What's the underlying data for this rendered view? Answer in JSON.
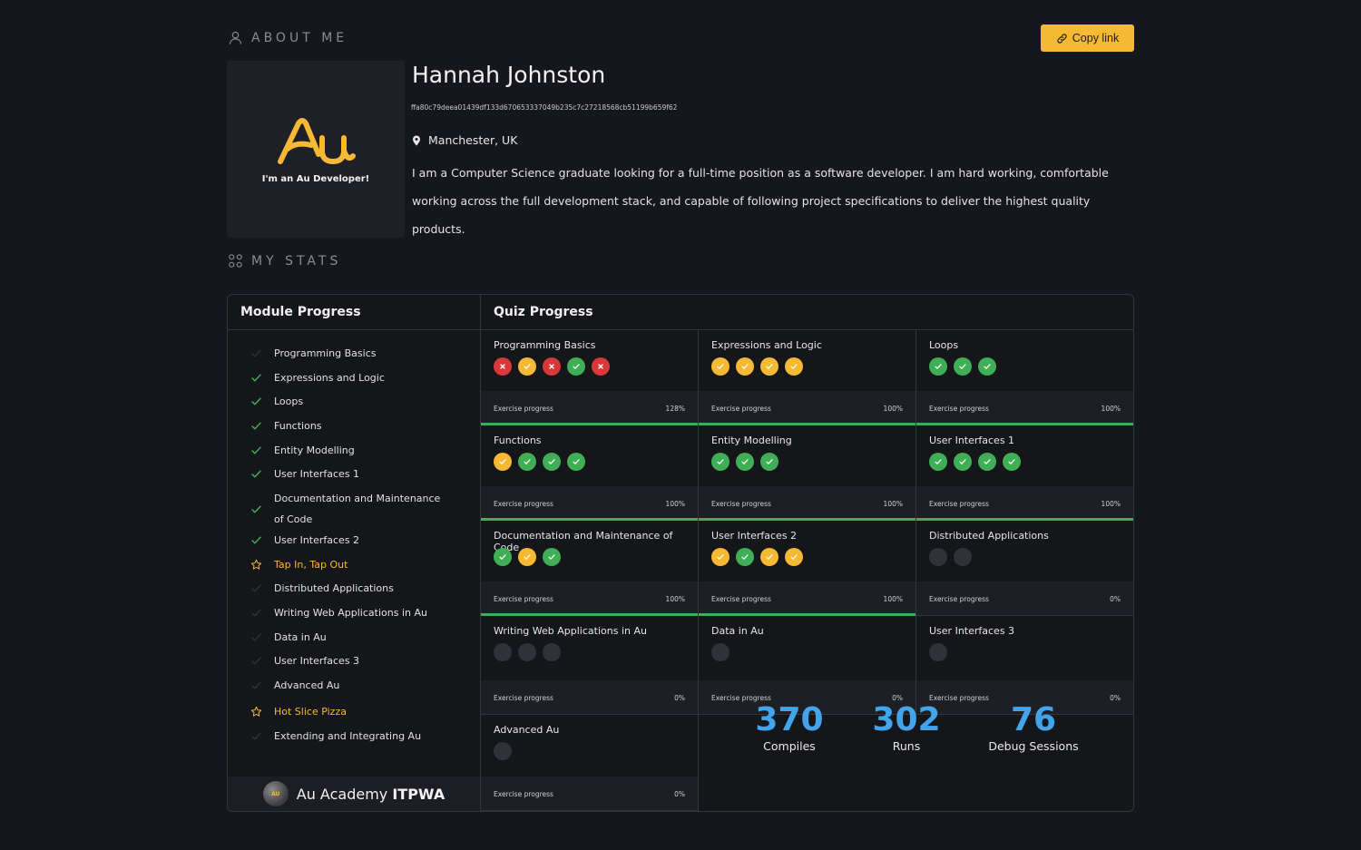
{
  "header": {
    "about_label": "ABOUT ME",
    "copy_link_label": "Copy link",
    "stats_label": "MY STATS"
  },
  "profile": {
    "avatar_tagline": "I'm an Au Developer!",
    "name": "Hannah Johnston",
    "hash": "ffa80c79deea01439df133d670653337049b235c7c27218568cb51199b659f62",
    "location": "Manchester, UK",
    "bio": "I am a Computer Science graduate looking for a full-time position as a software developer. I am hard working, comfortable working across the full development stack, and capable of following project specifications to deliver the highest quality products."
  },
  "module_progress": {
    "title": "Module Progress",
    "items": [
      {
        "label": "Programming Basics",
        "status": "faint"
      },
      {
        "label": "Expressions and Logic",
        "status": "done"
      },
      {
        "label": "Loops",
        "status": "done"
      },
      {
        "label": "Functions",
        "status": "done"
      },
      {
        "label": "Entity Modelling",
        "status": "done"
      },
      {
        "label": "User Interfaces 1",
        "status": "done"
      },
      {
        "label": "Documentation and Maintenance of Code",
        "status": "done"
      },
      {
        "label": "User Interfaces 2",
        "status": "done"
      },
      {
        "label": "Tap In, Tap Out",
        "status": "star"
      },
      {
        "label": "Distributed Applications",
        "status": "faint"
      },
      {
        "label": "Writing Web Applications in Au",
        "status": "faint"
      },
      {
        "label": "Data in Au",
        "status": "faint"
      },
      {
        "label": "User Interfaces 3",
        "status": "faint"
      },
      {
        "label": "Advanced Au",
        "status": "faint"
      },
      {
        "label": "Hot Slice Pizza",
        "status": "star"
      },
      {
        "label": "Extending and Integrating Au",
        "status": "faint"
      }
    ]
  },
  "brand": {
    "logo_text": "AU",
    "name_regular": "Au Academy ",
    "name_bold": "ITPWA"
  },
  "quiz_progress": {
    "title": "Quiz Progress",
    "progress_label": "Exercise progress",
    "quizzes": [
      {
        "title": "Programming Basics",
        "dots": [
          "red",
          "yellow",
          "red",
          "green",
          "red"
        ],
        "progress_text": "128%",
        "progress": 1.28
      },
      {
        "title": "Expressions and Logic",
        "dots": [
          "yellow",
          "yellow",
          "yellow",
          "yellow"
        ],
        "progress_text": "100%",
        "progress": 1.0
      },
      {
        "title": "Loops",
        "dots": [
          "green",
          "green",
          "green"
        ],
        "progress_text": "100%",
        "progress": 1.0
      },
      {
        "title": "Functions",
        "dots": [
          "yellow",
          "green",
          "green",
          "green"
        ],
        "progress_text": "100%",
        "progress": 1.0
      },
      {
        "title": "Entity Modelling",
        "dots": [
          "green",
          "green",
          "green"
        ],
        "progress_text": "100%",
        "progress": 1.0
      },
      {
        "title": "User Interfaces 1",
        "dots": [
          "green",
          "green",
          "green",
          "green"
        ],
        "progress_text": "100%",
        "progress": 1.0
      },
      {
        "title": "Documentation and Maintenance of Code",
        "dots": [
          "green",
          "yellow",
          "green"
        ],
        "progress_text": "100%",
        "progress": 1.0
      },
      {
        "title": "User Interfaces 2",
        "dots": [
          "yellow",
          "green",
          "yellow",
          "yellow"
        ],
        "progress_text": "100%",
        "progress": 1.0
      },
      {
        "title": "Distributed Applications",
        "dots": [
          "empty",
          "empty"
        ],
        "progress_text": "0%",
        "progress": 0
      },
      {
        "title": "Writing Web Applications in Au",
        "dots": [
          "empty",
          "empty",
          "empty"
        ],
        "progress_text": "0%",
        "progress": 0
      },
      {
        "title": "Data in Au",
        "dots": [
          "empty"
        ],
        "progress_text": "0%",
        "progress": 0
      },
      {
        "title": "User Interfaces 3",
        "dots": [
          "empty"
        ],
        "progress_text": "0%",
        "progress": 0
      },
      {
        "title": "Advanced Au",
        "dots": [
          "empty"
        ],
        "progress_text": "0%",
        "progress": 0
      }
    ]
  },
  "counters": [
    {
      "value": "370",
      "label": "Compiles"
    },
    {
      "value": "302",
      "label": "Runs"
    },
    {
      "value": "76",
      "label": "Debug Sessions"
    }
  ],
  "colors": {
    "accent_yellow": "#f5b934",
    "success_green": "#3fae56",
    "error_red": "#d93838",
    "counter_blue": "#42a4ea",
    "background": "#16171c"
  }
}
